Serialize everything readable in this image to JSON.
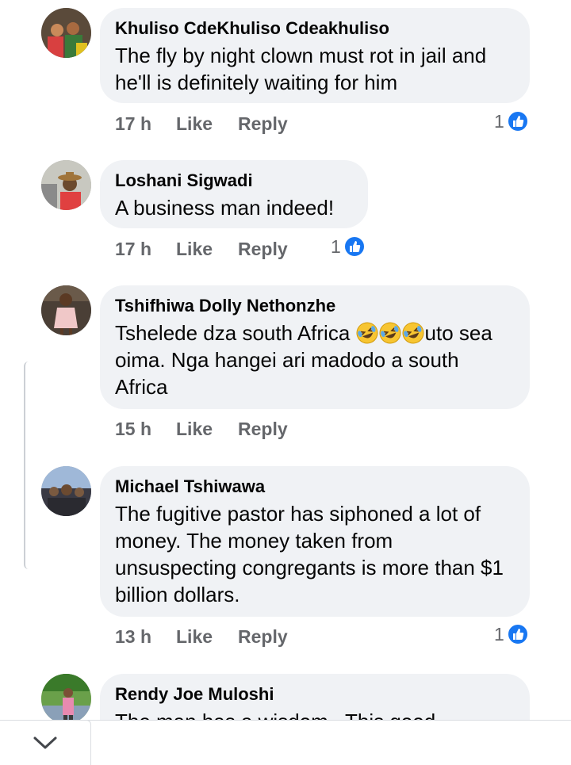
{
  "comments": [
    {
      "author": "Khuliso CdeKhuliso Cdeakhuliso",
      "text": "The fly by night clown must rot in jail and he'll is definitely waiting for him",
      "time": "17 h",
      "like_label": "Like",
      "reply_label": "Reply",
      "reaction_count": "1"
    },
    {
      "author": "Loshani Sigwadi",
      "text": "A business man indeed!",
      "time": "17 h",
      "like_label": "Like",
      "reply_label": "Reply",
      "reaction_count": "1"
    },
    {
      "author": "Tshifhiwa Dolly Nethonzhe",
      "text_before": "Tshelede dza south Africa ",
      "text_after": "uto sea oima. Nga hangei ari madodo a south Africa",
      "emoji": [
        "rolling-on-floor-laughing",
        "rolling-on-floor-laughing",
        "rolling-on-floor-laughing"
      ],
      "time": "15 h",
      "like_label": "Like",
      "reply_label": "Reply"
    },
    {
      "author": "Michael Tshiwawa",
      "text": "The fugitive pastor has siphoned a lot of money. The money taken from unsuspecting congregants is more than $1 billion dollars.",
      "time": "13 h",
      "like_label": "Like",
      "reply_label": "Reply",
      "reaction_count": "1"
    },
    {
      "author": "Rendy Joe Muloshi",
      "text": "The man has a wisdom.. This good investment"
    }
  ],
  "reaction_icon": "like-thumb-icon",
  "collapse_icon": "chevron-down-icon",
  "colors": {
    "bubble": "#f0f2f5",
    "meta": "#65676b",
    "like_blue": "#1877f2",
    "text": "#050505"
  }
}
